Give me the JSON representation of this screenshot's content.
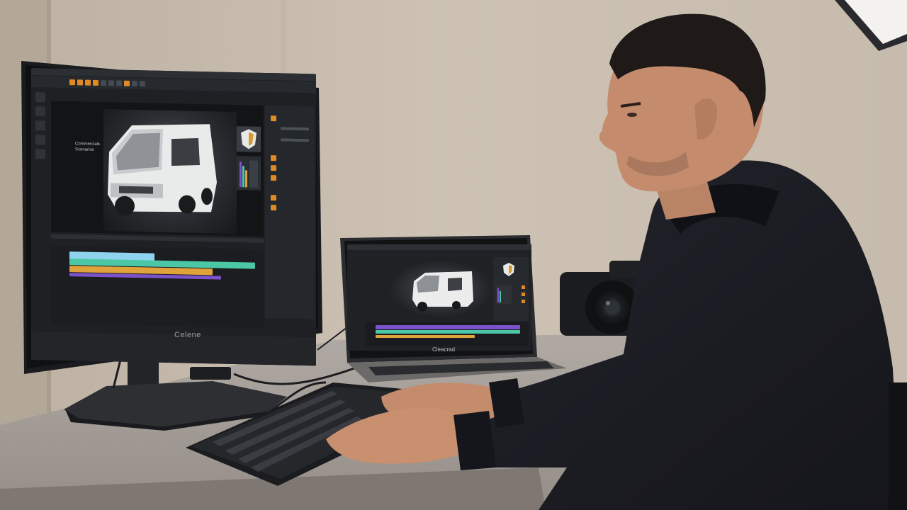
{
  "monitor": {
    "brand": "Celene",
    "viewport_label_1": "Commercials",
    "viewport_label_2": "Scenarios"
  },
  "laptop": {
    "brand": "Cleacrad"
  },
  "colors": {
    "wall": "#cbbfb1",
    "desk": "#a7a09a",
    "ui_dark": "#1e2023",
    "accent_orange": "#e08a25",
    "track_teal": "#4cc7a6",
    "track_orange": "#e0a23a",
    "track_purple": "#7a52c9",
    "track_blue": "#6bb9e6",
    "hoodie": "#1c1d24",
    "skin": "#c48c6c"
  },
  "icons": [
    "camera-icon",
    "van-model-icon",
    "shield-badge-icon"
  ]
}
